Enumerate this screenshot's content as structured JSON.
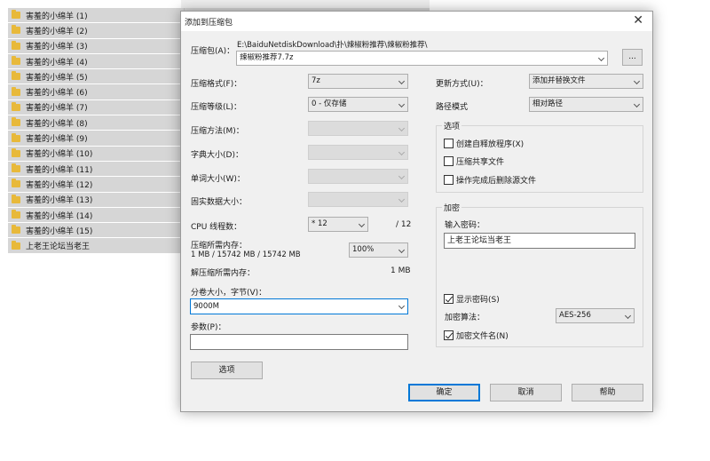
{
  "explorer": {
    "items": [
      "害羞的小绵羊 (1)",
      "害羞的小绵羊 (2)",
      "害羞的小绵羊 (3)",
      "害羞的小绵羊 (4)",
      "害羞的小绵羊 (5)",
      "害羞的小绵羊 (6)",
      "害羞的小绵羊 (7)",
      "害羞的小绵羊 (8)",
      "害羞的小绵羊 (9)",
      "害羞的小绵羊 (10)",
      "害羞的小绵羊 (11)",
      "害羞的小绵羊 (12)",
      "害羞的小绵羊 (13)",
      "害羞的小绵羊 (14)",
      "害羞的小绵羊 (15)",
      "上老王论坛当老王"
    ]
  },
  "dialog": {
    "title": "添加到压缩包",
    "close_icon": "close-icon",
    "archive_label": "压缩包(A)：",
    "archive_path": "E:\\BaiduNetdiskDownload\\扑\\辣椒粉推荐\\辣椒粉推荐\\",
    "archive_name": "辣椒粉推荐7.7z",
    "browse_label": "...",
    "format_label": "压缩格式(F)：",
    "format_value": "7z",
    "level_label": "压缩等级(L)：",
    "level_value": "0 - 仅存储",
    "method_label": "压缩方法(M)：",
    "dict_label": "字典大小(D)：",
    "word_label": "单词大小(W)：",
    "solid_label": "固实数据大小：",
    "threads_label": "CPU 线程数：",
    "threads_value": "* 12",
    "threads_max": "/ 12",
    "mem_comp_label": "压缩所需内存：",
    "mem_comp_detail": "1 MB / 15742 MB / 15742 MB",
    "mem_comp_value": "100%",
    "mem_decomp_label": "解压缩所需内存：",
    "mem_decomp_value": "1 MB",
    "split_label": "分卷大小，字节(V)：",
    "split_value": "9000M",
    "params_label": "参数(P)：",
    "params_value": "",
    "options_button": "选项",
    "update_label": "更新方式(U)：",
    "update_value": "添加并替换文件",
    "path_label": "路径模式",
    "path_value": "相对路径",
    "options_group": {
      "title": "选项",
      "sfx": "创建自释放程序(X)",
      "shared": "压缩共享文件",
      "delete_after": "操作完成后删除源文件"
    },
    "encryption_group": {
      "title": "加密",
      "password_label": "输入密码：",
      "password_value": "上老王论坛当老王",
      "show_password": "显示密码(S)",
      "method_label": "加密算法：",
      "method_value": "AES-256",
      "encrypt_names": "加密文件名(N)"
    },
    "ok_button": "确定",
    "cancel_button": "取消",
    "help_button": "帮助"
  }
}
